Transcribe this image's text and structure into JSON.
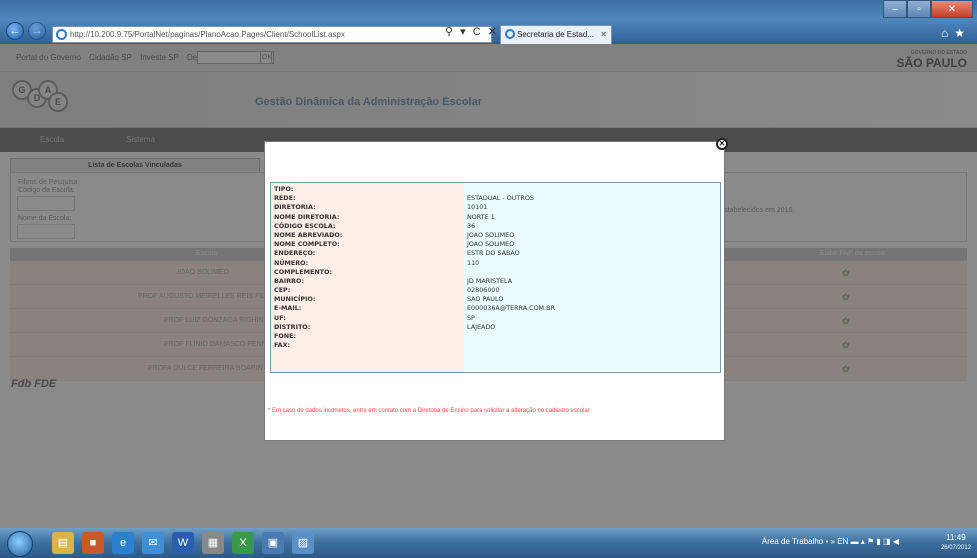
{
  "browser": {
    "url": "http://10.200.9.75/PortalNet/paginas/PlanoAcao.Pages/Client/SchoolList.aspx",
    "url_host": "10.200.9.75",
    "tab_title": "Secretaria de Estad...",
    "addr_actions": "⚲ ▾ C ✕"
  },
  "gov_bar": {
    "links": [
      "Portal do Governo",
      "Cidadão SP",
      "Investe SP",
      "Destaques"
    ],
    "select_value": "",
    "ok_label": "OK",
    "logo_small": "GOVERNO DO ESTADO",
    "logo_text": "SÃO PAULO"
  },
  "header": {
    "title": "Gestão Dinâmica da Administração Escolar",
    "logo_letters": [
      "G",
      "D",
      "A",
      "E"
    ]
  },
  "menu": [
    "Escola",
    "Sistema"
  ],
  "content": {
    "tab_label": "Lista de Escolas Vinculadas",
    "filter_title": "Filtros de Pesquisa",
    "code_label": "Código da Escola:",
    "name_label": "Nome da Escola:",
    "right_note": "os estabelecidos em 2010.",
    "col_escola": "Escola",
    "col_pap": "Exibir PAP da escola",
    "rows": [
      "JOAO SOLIMEO",
      "PROF AUGUSTO MEIRELLES REIS FILH",
      "PROF LUIZ GONZAGA RIGHINI",
      "PROF FLINIO DAMASCO PENNA",
      "PROFA DULCE FERREIRA BOARIN"
    ],
    "footer_logo": "Fdb FDE"
  },
  "modal": {
    "labels": [
      "TIPO:",
      "REDE:",
      "DIRETORIA:",
      "NOME DIRETORIA:",
      "CÓDIGO ESCOLA:",
      "NOME ABREVIADO:",
      "NOME COMPLETO:",
      "ENDEREÇO:",
      "NÚMERO:",
      "COMPLEMENTO:",
      "BAIRRO:",
      "CEP:",
      "MUNICÍPIO:",
      "E-MAIL:",
      "UF:",
      "DISTRITO:",
      "FONE:",
      "FAX:"
    ],
    "values": [
      "",
      "ESTADUAL - OUTROS",
      "10101",
      "NORTE 1",
      "36",
      "JOAO SOLIMEO",
      "JOAO SOLIMEO",
      "ESTR DO SABAO",
      "110",
      "",
      "JD MARISTELA",
      "02806000",
      "SAO PAULO",
      "E000036A@TERRA.COM.BR",
      "SP",
      "LAJEADO",
      "",
      ""
    ],
    "warning": "* Em caso de dados incorretos, entre em contato com a Diretoria de Ensino para solicitar a alteração no cadastro escolar"
  },
  "taskbar": {
    "tray_text": "Área de Trabalho",
    "lang": "EN",
    "time": "11:49",
    "date": "26/07/2012"
  }
}
